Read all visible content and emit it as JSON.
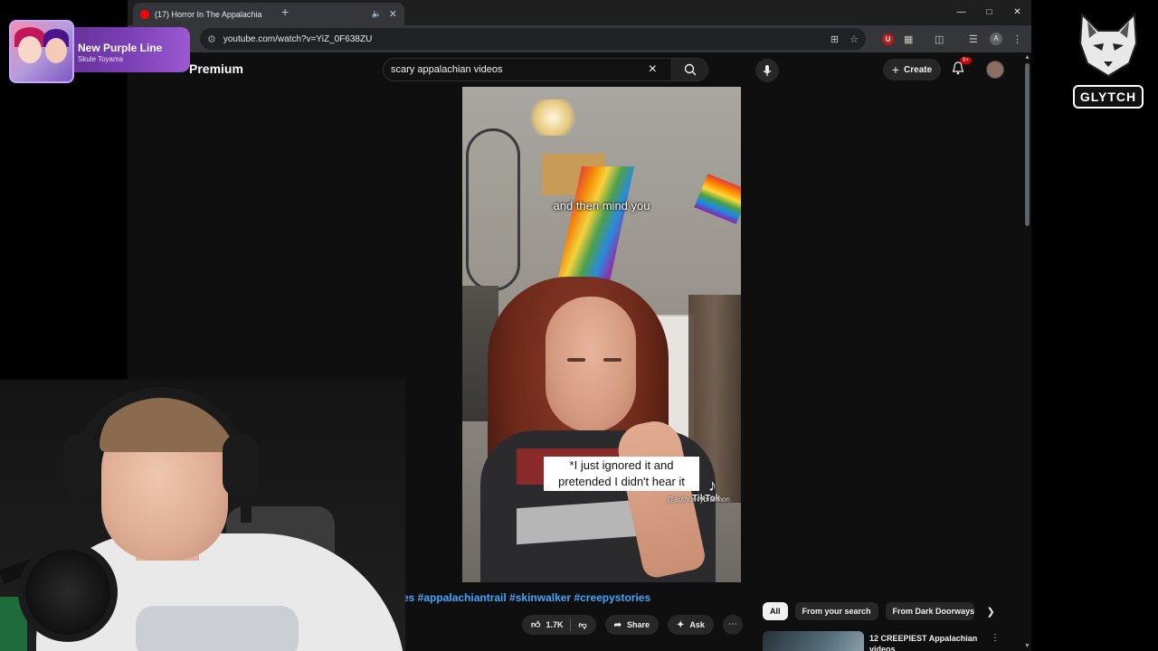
{
  "browser": {
    "tab_title": "(17) Horror In The Appalachia",
    "new_tab_symbol": "+",
    "url": "youtube.com/watch?v=YiZ_0F638ZU"
  },
  "youtube": {
    "brand_suffix": "Premium",
    "search_query": "scary appalachian videos",
    "create_label": "Create",
    "notif_badge": "9+",
    "video_caption_top": "and then mind you",
    "video_caption_main": "*I just ignored it and pretended I didn't hear it",
    "watermark": "TikTok",
    "watermark_handle": "@authorivybrannon",
    "hashtags": "ries #appalachiantrail #skinwalker #creepystories",
    "like_count": "1.7K",
    "share_label": "Share",
    "ask_label": "Ask",
    "chips": [
      "All",
      "From your search",
      "From Dark Doorways TV"
    ],
    "rec_title": "12 CREEPIEST Appalachian videos"
  },
  "overlay": {
    "now_playing_song": "New Purple Line",
    "now_playing_artist": "Skule Toyama",
    "logo_text": "GLYTCH"
  },
  "colors": {
    "accent_link": "#3ea6ff",
    "yt_red": "#ff0000",
    "now_playing_purple": "#7b3fb6"
  }
}
